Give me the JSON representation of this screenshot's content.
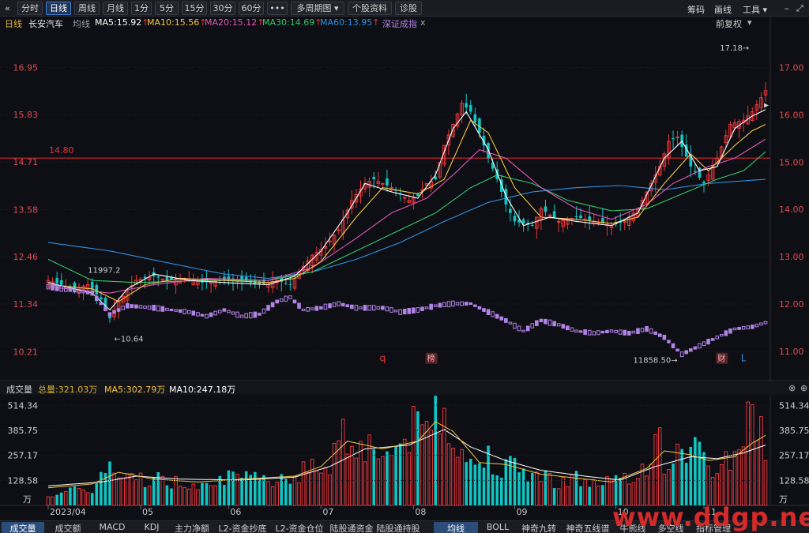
{
  "toolbar": {
    "back_glyph": "«",
    "periods": [
      "分时",
      "日线",
      "周线",
      "月线",
      "1分",
      "5分",
      "15分",
      "30分",
      "60分",
      "•••"
    ],
    "active_period": "日线",
    "multi_period": "多周期图",
    "stock_info": "个股资料",
    "diagnose": "诊股",
    "right": [
      "筹码",
      "画线",
      "工具"
    ],
    "icons": [
      "dropdown-caret-icon",
      "minimize-icon",
      "maximize-icon"
    ]
  },
  "indicators": {
    "period_label": "日线",
    "stock_name": "长安汽车",
    "avg_line": "均线",
    "ma5": "MA5:15.92",
    "ma10": "MA10:15.56",
    "ma20": "MA20:15.12",
    "ma30": "MA30:14.69",
    "ma60": "MA60:13.95",
    "index": "深证成指",
    "close_x": "x",
    "restore": "前复权"
  },
  "colors": {
    "up": "#e8363c",
    "down": "#11c5c4",
    "ma5": "#ffffff",
    "ma10": "#f5c542",
    "ma20": "#e156b8",
    "ma30": "#35c76a",
    "ma60": "#2f8fe0",
    "index": "#b183e6",
    "ref_line": "#c3282f",
    "bg": "#0e0f14"
  },
  "annotations": {
    "high": "17.18→",
    "low": "←10.64",
    "first_mark": "11997.2",
    "ref_value": "14.80",
    "index_low": "11858.50→",
    "tag_q": "q",
    "tag_bang": "榜",
    "tag_cai": "财",
    "tag_l": "L"
  },
  "volume": {
    "title": "成交量",
    "total": "总量:321.03万",
    "ma5": "MA5:302.79万",
    "ma10": "MA10:247.18万",
    "unit": "万",
    "ticks": [
      "514.34",
      "385.75",
      "257.17",
      "128.58"
    ]
  },
  "bottom_tabs": [
    "成交量",
    "成交额",
    "MACD",
    "KDJ",
    "主力净额",
    "L2-资金抄底",
    "L2-资金仓位",
    "陆股通资金",
    "陆股通持股",
    "均线",
    "BOLL",
    "神奇九转",
    "神奇五线谱",
    "牛熊线",
    "多空线",
    "指标管理"
  ],
  "bottom_selected": [
    "成交量",
    "均线"
  ],
  "watermark": "www.ddgp.net",
  "chart_data": {
    "type": "candlestick",
    "x_ticks": [
      "2023/04",
      "05",
      "06",
      "07",
      "08",
      "09",
      "10",
      "11"
    ],
    "y_left": [
      "16.95",
      "15.83",
      "14.71",
      "13.58",
      "12.46",
      "11.34",
      "10.21"
    ],
    "y_right": [
      "17.00",
      "16.00",
      "15.00",
      "14.00",
      "13.00",
      "12.00",
      "11.00"
    ],
    "ylim": [
      9.6,
      17.8
    ],
    "ref_line": 14.8,
    "x_label_index": [
      0,
      21,
      41,
      62,
      83,
      106,
      129,
      149
    ],
    "anchors": [
      [
        0,
        11.9
      ],
      [
        6,
        11.7
      ],
      [
        9,
        11.8
      ],
      [
        12,
        11.45
      ],
      [
        14,
        11.0
      ],
      [
        16,
        11.4
      ],
      [
        20,
        11.9
      ],
      [
        24,
        12.0
      ],
      [
        27,
        11.9
      ],
      [
        31,
        11.95
      ],
      [
        35,
        11.85
      ],
      [
        40,
        11.9
      ],
      [
        44,
        11.9
      ],
      [
        48,
        11.8
      ],
      [
        52,
        11.9
      ],
      [
        55,
        11.8
      ],
      [
        57,
        12.1
      ],
      [
        60,
        12.5
      ],
      [
        63,
        12.7
      ],
      [
        66,
        13.1
      ],
      [
        69,
        13.8
      ],
      [
        72,
        14.2
      ],
      [
        74,
        14.3
      ],
      [
        78,
        14.1
      ],
      [
        82,
        13.8
      ],
      [
        84,
        13.9
      ],
      [
        86,
        14.2
      ],
      [
        88,
        14.3
      ],
      [
        90,
        15.1
      ],
      [
        92,
        15.6
      ],
      [
        94,
        16.1
      ],
      [
        96,
        15.9
      ],
      [
        98,
        15.4
      ],
      [
        100,
        14.8
      ],
      [
        102,
        14.3
      ],
      [
        104,
        13.7
      ],
      [
        106,
        13.3
      ],
      [
        110,
        13.2
      ],
      [
        112,
        13.6
      ],
      [
        116,
        13.3
      ],
      [
        120,
        13.4
      ],
      [
        124,
        13.3
      ],
      [
        128,
        13.2
      ],
      [
        131,
        13.3
      ],
      [
        134,
        13.6
      ],
      [
        137,
        14.2
      ],
      [
        139,
        14.6
      ],
      [
        141,
        15.2
      ],
      [
        143,
        15.3
      ],
      [
        146,
        14.6
      ],
      [
        149,
        14.2
      ],
      [
        152,
        14.8
      ],
      [
        155,
        15.6
      ],
      [
        158,
        15.7
      ],
      [
        160,
        15.9
      ],
      [
        163,
        16.4
      ]
    ],
    "ma5": [
      [
        0,
        11.85
      ],
      [
        10,
        11.6
      ],
      [
        14,
        11.2
      ],
      [
        18,
        11.7
      ],
      [
        24,
        12.05
      ],
      [
        32,
        11.9
      ],
      [
        40,
        11.85
      ],
      [
        50,
        11.8
      ],
      [
        56,
        12.0
      ],
      [
        62,
        12.6
      ],
      [
        68,
        13.5
      ],
      [
        72,
        14.2
      ],
      [
        78,
        14.0
      ],
      [
        84,
        13.85
      ],
      [
        88,
        14.4
      ],
      [
        92,
        15.5
      ],
      [
        95,
        15.9
      ],
      [
        100,
        15.0
      ],
      [
        104,
        13.9
      ],
      [
        108,
        13.2
      ],
      [
        114,
        13.4
      ],
      [
        120,
        13.3
      ],
      [
        128,
        13.2
      ],
      [
        134,
        13.5
      ],
      [
        140,
        14.8
      ],
      [
        144,
        15.2
      ],
      [
        148,
        14.5
      ],
      [
        152,
        14.6
      ],
      [
        156,
        15.5
      ],
      [
        160,
        15.8
      ],
      [
        163,
        15.95
      ]
    ],
    "ma10": [
      [
        0,
        11.8
      ],
      [
        10,
        11.7
      ],
      [
        16,
        11.4
      ],
      [
        22,
        11.8
      ],
      [
        30,
        11.95
      ],
      [
        40,
        11.9
      ],
      [
        50,
        11.85
      ],
      [
        56,
        11.95
      ],
      [
        62,
        12.35
      ],
      [
        70,
        13.4
      ],
      [
        76,
        14.1
      ],
      [
        84,
        13.95
      ],
      [
        90,
        14.3
      ],
      [
        96,
        15.7
      ],
      [
        100,
        15.4
      ],
      [
        106,
        14.1
      ],
      [
        112,
        13.4
      ],
      [
        120,
        13.35
      ],
      [
        128,
        13.25
      ],
      [
        134,
        13.4
      ],
      [
        140,
        14.2
      ],
      [
        146,
        14.9
      ],
      [
        150,
        14.5
      ],
      [
        156,
        15.1
      ],
      [
        160,
        15.45
      ],
      [
        163,
        15.6
      ]
    ],
    "ma20": [
      [
        0,
        11.75
      ],
      [
        14,
        11.6
      ],
      [
        24,
        11.8
      ],
      [
        36,
        11.95
      ],
      [
        50,
        11.9
      ],
      [
        60,
        12.2
      ],
      [
        70,
        12.9
      ],
      [
        78,
        13.5
      ],
      [
        86,
        13.85
      ],
      [
        92,
        14.4
      ],
      [
        98,
        15.0
      ],
      [
        104,
        14.8
      ],
      [
        112,
        14.1
      ],
      [
        120,
        13.6
      ],
      [
        128,
        13.35
      ],
      [
        136,
        13.7
      ],
      [
        142,
        14.2
      ],
      [
        150,
        14.6
      ],
      [
        156,
        14.8
      ],
      [
        163,
        15.25
      ]
    ],
    "ma30": [
      [
        0,
        12.4
      ],
      [
        10,
        11.9
      ],
      [
        20,
        11.85
      ],
      [
        36,
        11.9
      ],
      [
        50,
        11.9
      ],
      [
        60,
        12.1
      ],
      [
        70,
        12.6
      ],
      [
        80,
        13.1
      ],
      [
        88,
        13.5
      ],
      [
        96,
        14.1
      ],
      [
        102,
        14.4
      ],
      [
        110,
        14.2
      ],
      [
        118,
        13.8
      ],
      [
        128,
        13.55
      ],
      [
        136,
        13.6
      ],
      [
        144,
        13.95
      ],
      [
        152,
        14.3
      ],
      [
        158,
        14.5
      ],
      [
        163,
        14.95
      ]
    ],
    "ma60": [
      [
        0,
        12.8
      ],
      [
        14,
        12.6
      ],
      [
        28,
        12.3
      ],
      [
        40,
        12.05
      ],
      [
        50,
        11.95
      ],
      [
        60,
        12.1
      ],
      [
        70,
        12.4
      ],
      [
        80,
        12.8
      ],
      [
        90,
        13.3
      ],
      [
        100,
        13.75
      ],
      [
        110,
        14.0
      ],
      [
        120,
        14.1
      ],
      [
        130,
        14.15
      ],
      [
        140,
        14.05
      ],
      [
        150,
        14.2
      ],
      [
        163,
        14.3
      ]
    ],
    "index": [
      [
        0,
        11.75
      ],
      [
        10,
        11.6
      ],
      [
        14,
        11.1
      ],
      [
        18,
        11.3
      ],
      [
        24,
        11.25
      ],
      [
        32,
        11.15
      ],
      [
        36,
        11.05
      ],
      [
        40,
        11.2
      ],
      [
        44,
        11.05
      ],
      [
        48,
        11.1
      ],
      [
        52,
        11.4
      ],
      [
        55,
        11.5
      ],
      [
        58,
        11.2
      ],
      [
        62,
        11.25
      ],
      [
        66,
        11.35
      ],
      [
        70,
        11.25
      ],
      [
        76,
        11.25
      ],
      [
        80,
        11.15
      ],
      [
        84,
        11.2
      ],
      [
        88,
        11.3
      ],
      [
        92,
        11.35
      ],
      [
        96,
        11.35
      ],
      [
        100,
        11.15
      ],
      [
        104,
        10.95
      ],
      [
        108,
        10.7
      ],
      [
        112,
        10.95
      ],
      [
        116,
        10.85
      ],
      [
        120,
        10.7
      ],
      [
        124,
        10.65
      ],
      [
        128,
        10.7
      ],
      [
        132,
        10.65
      ],
      [
        136,
        10.75
      ],
      [
        140,
        10.55
      ],
      [
        144,
        10.15
      ],
      [
        148,
        10.35
      ],
      [
        152,
        10.55
      ],
      [
        156,
        10.75
      ],
      [
        160,
        10.8
      ],
      [
        163,
        10.9
      ]
    ],
    "volume": [
      [
        0,
        60
      ],
      [
        5,
        70
      ],
      [
        10,
        90
      ],
      [
        14,
        200
      ],
      [
        17,
        120
      ],
      [
        20,
        150
      ],
      [
        26,
        130
      ],
      [
        32,
        110
      ],
      [
        38,
        150
      ],
      [
        44,
        130
      ],
      [
        50,
        140
      ],
      [
        56,
        160
      ],
      [
        60,
        190
      ],
      [
        64,
        220
      ],
      [
        66,
        380
      ],
      [
        70,
        330
      ],
      [
        74,
        300
      ],
      [
        78,
        260
      ],
      [
        82,
        380
      ],
      [
        86,
        400
      ],
      [
        88,
        500
      ],
      [
        90,
        500
      ],
      [
        92,
        390
      ],
      [
        96,
        200
      ],
      [
        100,
        260
      ],
      [
        104,
        200
      ],
      [
        108,
        180
      ],
      [
        112,
        150
      ],
      [
        116,
        130
      ],
      [
        120,
        140
      ],
      [
        124,
        110
      ],
      [
        128,
        130
      ],
      [
        132,
        120
      ],
      [
        136,
        210
      ],
      [
        138,
        390
      ],
      [
        140,
        230
      ],
      [
        144,
        250
      ],
      [
        146,
        360
      ],
      [
        150,
        180
      ],
      [
        156,
        260
      ],
      [
        160,
        490
      ],
      [
        163,
        320
      ]
    ],
    "vol_ma5": [
      [
        0,
        90
      ],
      [
        10,
        110
      ],
      [
        16,
        170
      ],
      [
        24,
        135
      ],
      [
        34,
        120
      ],
      [
        44,
        135
      ],
      [
        56,
        150
      ],
      [
        62,
        200
      ],
      [
        68,
        330
      ],
      [
        76,
        290
      ],
      [
        84,
        330
      ],
      [
        88,
        430
      ],
      [
        92,
        380
      ],
      [
        98,
        220
      ],
      [
        104,
        210
      ],
      [
        112,
        160
      ],
      [
        120,
        140
      ],
      [
        128,
        120
      ],
      [
        136,
        190
      ],
      [
        140,
        280
      ],
      [
        146,
        260
      ],
      [
        150,
        230
      ],
      [
        156,
        250
      ],
      [
        160,
        320
      ],
      [
        163,
        360
      ]
    ],
    "vol_ma10": [
      [
        0,
        100
      ],
      [
        12,
        120
      ],
      [
        20,
        150
      ],
      [
        30,
        135
      ],
      [
        44,
        130
      ],
      [
        56,
        145
      ],
      [
        64,
        200
      ],
      [
        72,
        290
      ],
      [
        82,
        310
      ],
      [
        90,
        390
      ],
      [
        96,
        300
      ],
      [
        104,
        230
      ],
      [
        112,
        180
      ],
      [
        122,
        150
      ],
      [
        130,
        130
      ],
      [
        138,
        200
      ],
      [
        146,
        250
      ],
      [
        152,
        240
      ],
      [
        158,
        270
      ],
      [
        163,
        310
      ]
    ]
  }
}
